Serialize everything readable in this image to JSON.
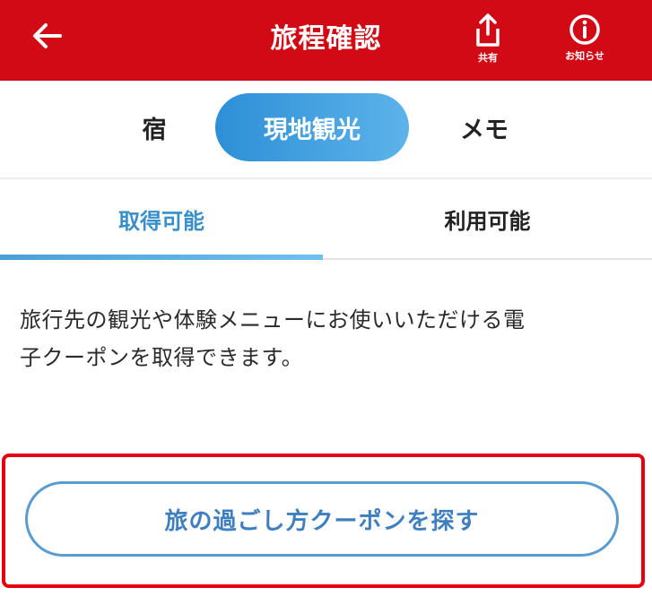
{
  "header": {
    "title": "旅程確認",
    "share_label": "共有",
    "info_label": "お知らせ",
    "background": "#d10a15"
  },
  "segments": {
    "items": [
      "宿",
      "現地観光",
      "メモ"
    ],
    "selected": "現地観光"
  },
  "tabs": {
    "items": [
      "取得可能",
      "利用可能"
    ],
    "selected": "取得可能"
  },
  "content": {
    "description_line1": "旅行先の観光や体験メニューにお使いいただける電",
    "description_line2": "子クーポンを取得できます。"
  },
  "actions": {
    "find_coupon_label": "旅の過ごし方クーポンを探す",
    "highlight_color": "#e60012"
  },
  "icons": {
    "back": "arrow-left-icon",
    "share": "share-icon",
    "info": "info-circle-icon"
  }
}
